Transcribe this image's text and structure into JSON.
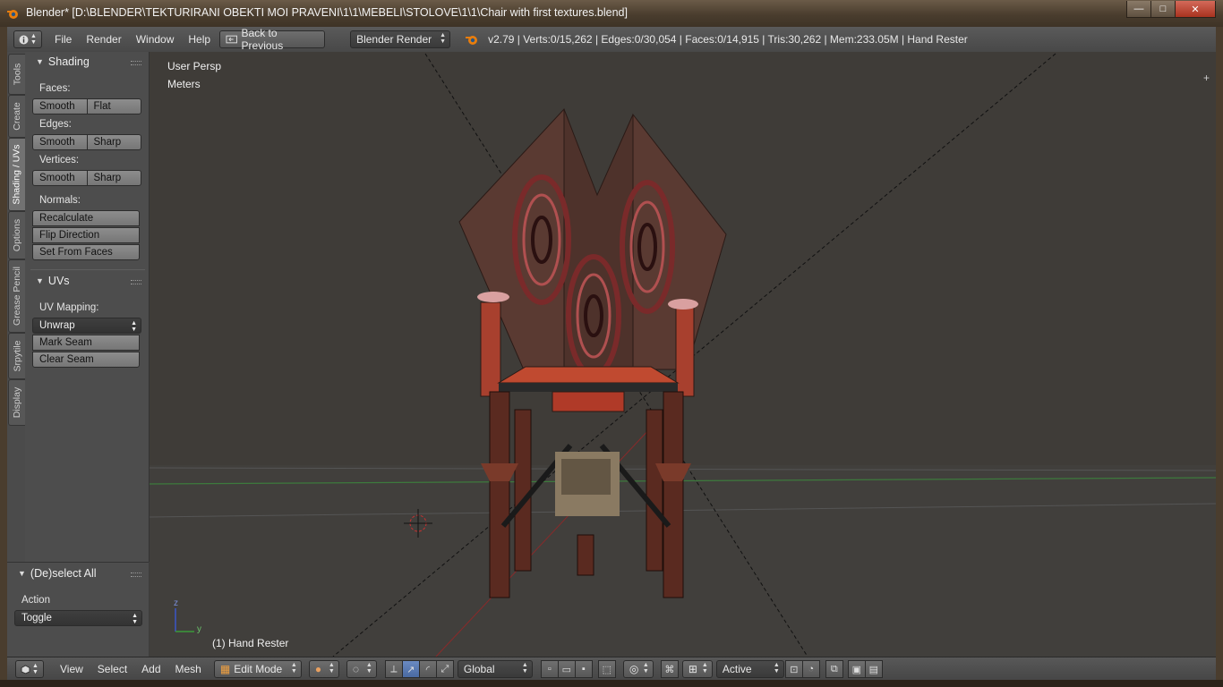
{
  "window": {
    "title": "Blender* [D:\\BLENDER\\TEKTURIRANI OBEKTI MOI PRAVENI\\1\\1\\MEBELI\\STOLOVE\\1\\1\\Chair with first textures.blend]",
    "minimize_glyph": "—",
    "maximize_glyph": "□",
    "close_glyph": "✕"
  },
  "info_header": {
    "menus": [
      "File",
      "Render",
      "Window",
      "Help"
    ],
    "back_button": "Back to Previous",
    "render_engine": "Blender Render",
    "stats": "v2.79 | Verts:0/15,262 | Edges:0/30,054 | Faces:0/14,915 | Tris:30,262 | Mem:233.05M | Hand Rester"
  },
  "tabs": [
    "Tools",
    "Create",
    "Shading / UVs",
    "Options",
    "Grease Pencil",
    "Srpytile",
    "Display"
  ],
  "shading_panel": {
    "title": "Shading",
    "faces_label": "Faces:",
    "faces_smooth": "Smooth",
    "faces_flat": "Flat",
    "edges_label": "Edges:",
    "edges_smooth": "Smooth",
    "edges_sharp": "Sharp",
    "vertices_label": "Vertices:",
    "vertices_smooth": "Smooth",
    "vertices_sharp": "Sharp",
    "normals_label": "Normals:",
    "recalculate": "Recalculate",
    "flip_direction": "Flip Direction",
    "set_from_faces": "Set From Faces"
  },
  "uvs_panel": {
    "title": "UVs",
    "uv_mapping_label": "UV Mapping:",
    "unwrap": "Unwrap",
    "mark_seam": "Mark Seam",
    "clear_seam": "Clear Seam"
  },
  "operator_panel": {
    "title": "(De)select All",
    "action_label": "Action",
    "action_value": "Toggle"
  },
  "viewport": {
    "view_name": "User Persp",
    "units": "Meters",
    "object_info": "(1) Hand Rester",
    "axis_z": "z",
    "axis_y": "y"
  },
  "view_header": {
    "menus": [
      "View",
      "Select",
      "Add",
      "Mesh"
    ],
    "mode": "Edit Mode",
    "orientation": "Global",
    "snap_target": "Active"
  }
}
